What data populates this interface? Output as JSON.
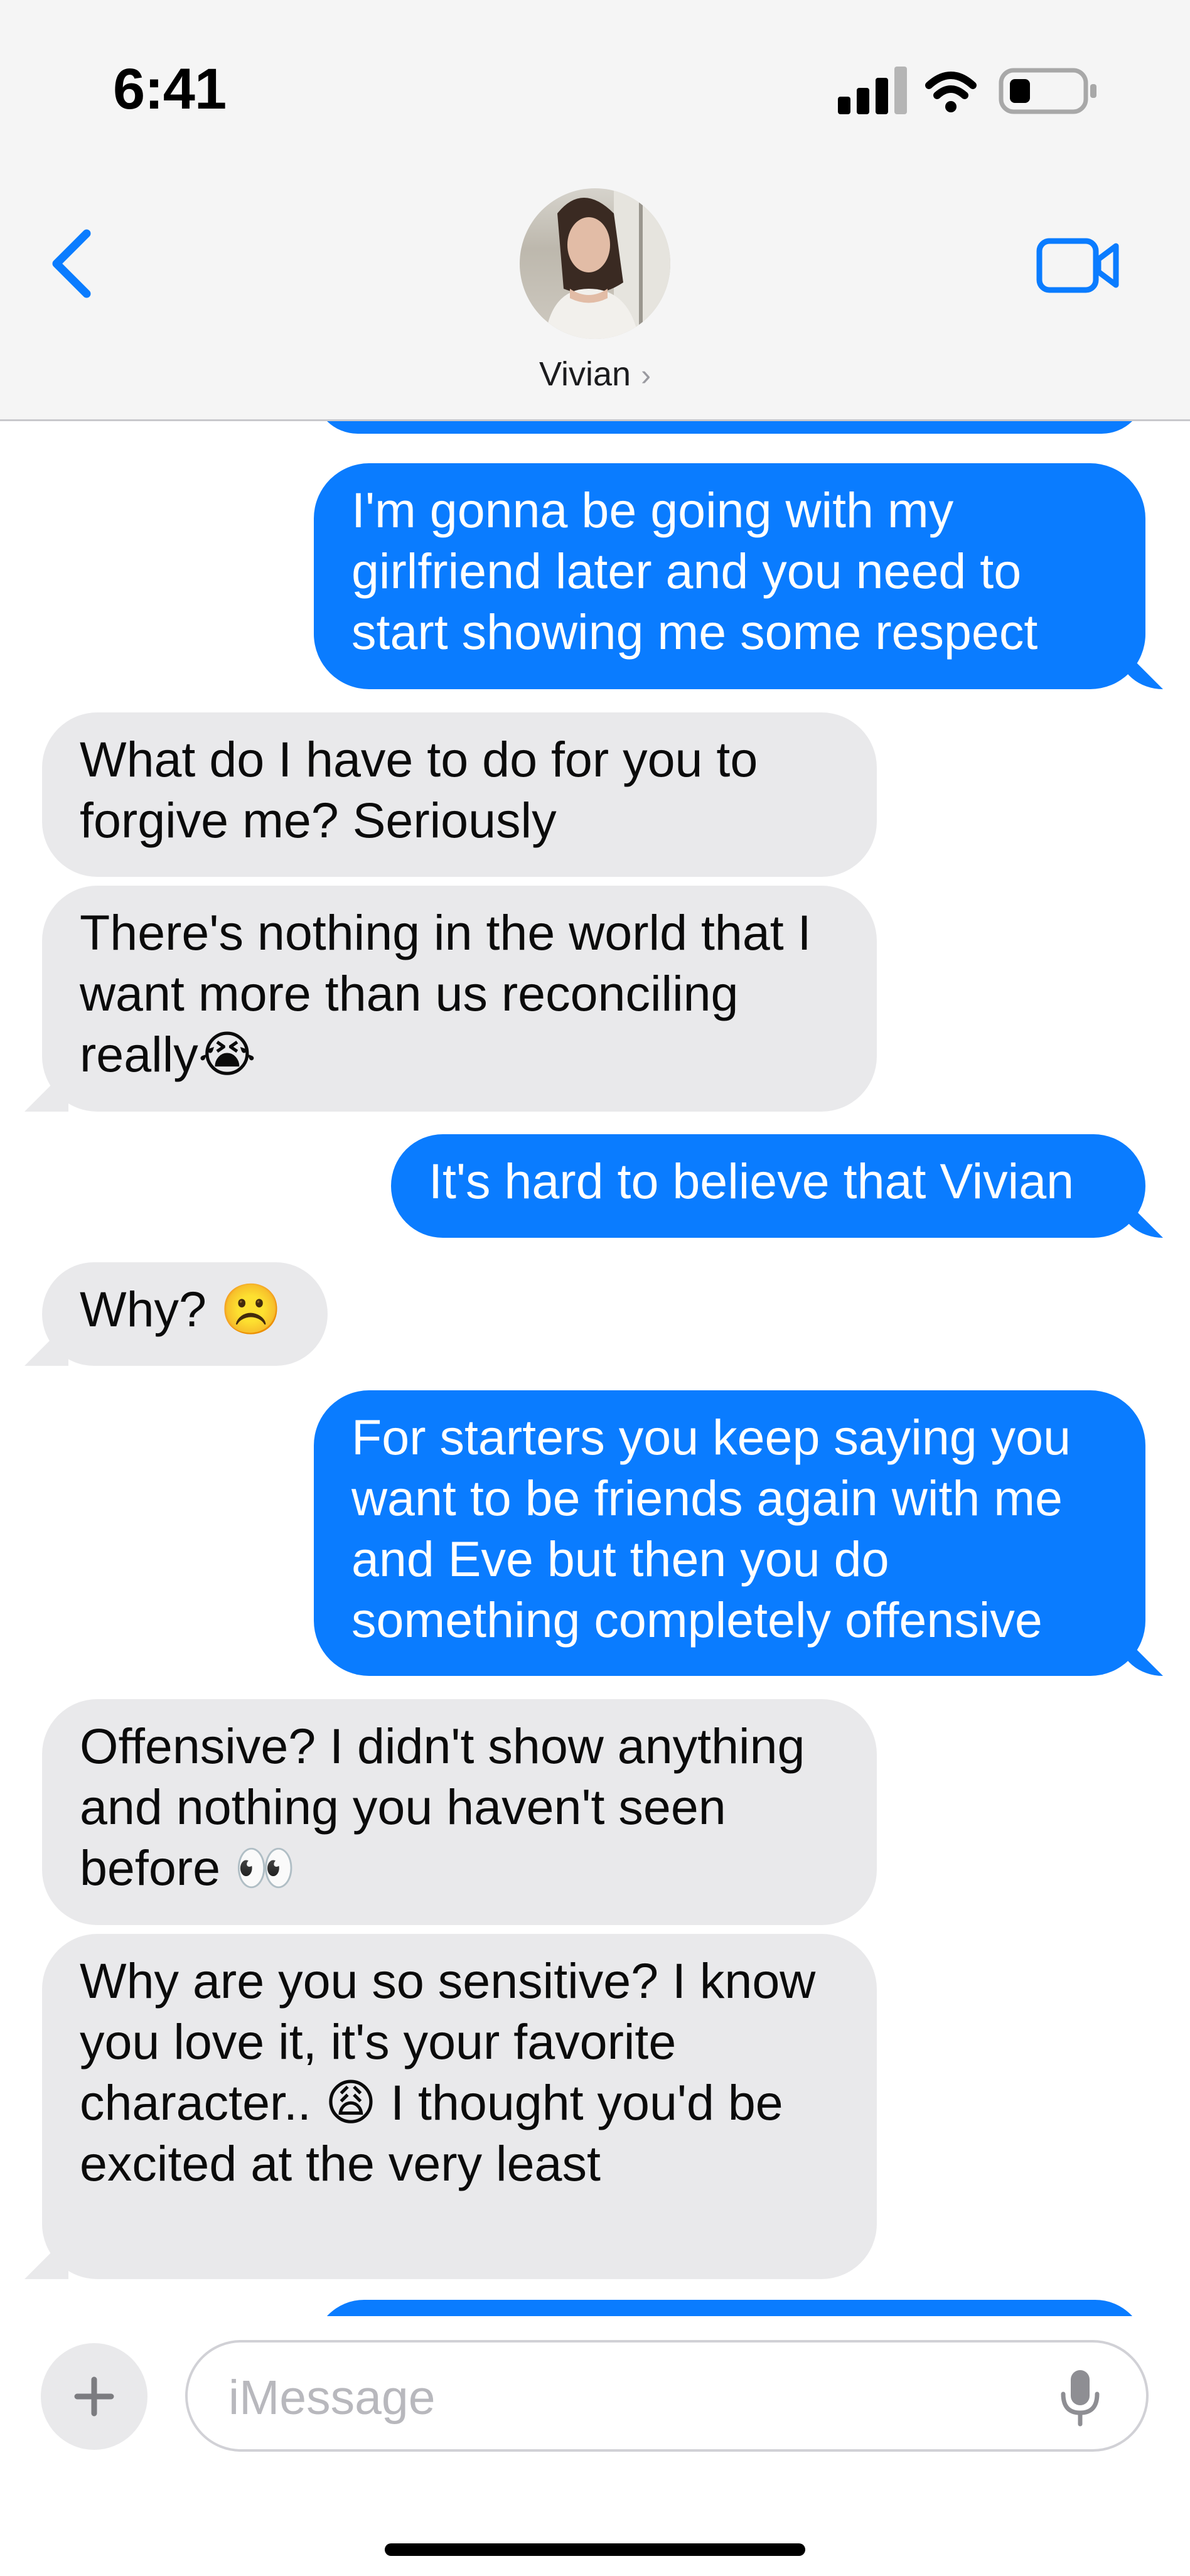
{
  "status_bar": {
    "time": "6:41"
  },
  "header": {
    "contact_name": "Vivian"
  },
  "messages": [
    {
      "side": "sent",
      "text": "I'm gonna be going with my girlfriend later and you need to start showing me some respect"
    },
    {
      "side": "received",
      "text": "What do I have to do for you to forgive me? Seriously"
    },
    {
      "side": "received",
      "text": "There's nothing in the world that I want more than us reconciling really😭"
    },
    {
      "side": "sent",
      "text": "It's hard to believe that Vivian"
    },
    {
      "side": "received",
      "text": "Why? ☹️"
    },
    {
      "side": "sent",
      "text": "For starters you keep saying you want to be friends again with me and Eve but then you do something completely offensive"
    },
    {
      "side": "received",
      "text": "Offensive? I didn't show anything and nothing you haven't seen before 👀"
    },
    {
      "side": "received",
      "text": "Why are you so sensitive? I know you love it, it's your favorite character.. 😩 I thought you'd be excited at the very least"
    }
  ],
  "composer": {
    "placeholder": "iMessage"
  },
  "colors": {
    "sent_bubble": "#0a7cff",
    "received_bubble": "#e9e9eb",
    "accent": "#0a7cff"
  }
}
